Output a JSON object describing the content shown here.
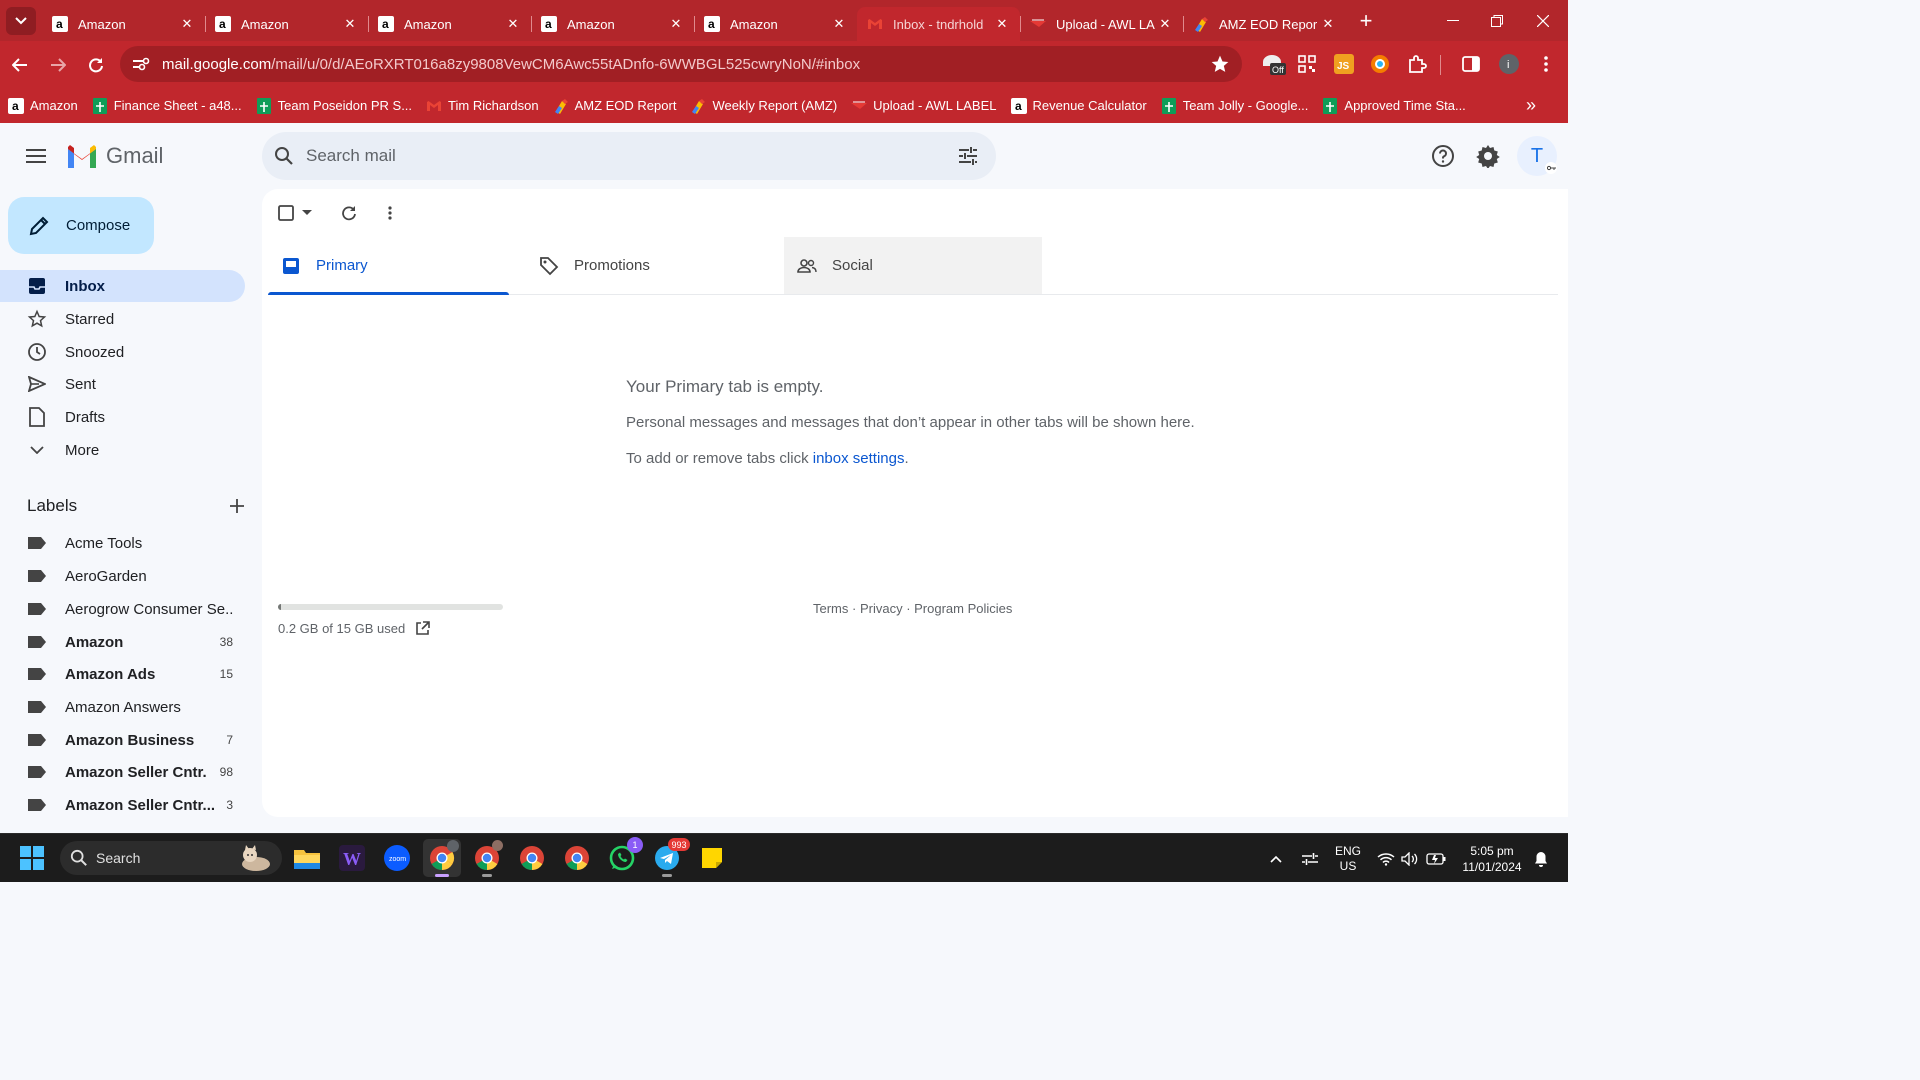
{
  "browser": {
    "tabs": [
      {
        "title": "Amazon",
        "favicon": "amazon-icon",
        "active": false
      },
      {
        "title": "Amazon",
        "favicon": "amazon-icon",
        "active": false
      },
      {
        "title": "Amazon",
        "favicon": "amazon-icon",
        "active": false
      },
      {
        "title": "Amazon",
        "favicon": "amazon-icon",
        "active": false
      },
      {
        "title": "Amazon",
        "favicon": "amazon-icon",
        "active": false
      },
      {
        "title": "Inbox - tndrhold",
        "favicon": "gmail-icon",
        "active": true
      },
      {
        "title": "Upload - AWL LA",
        "favicon": "awl-icon",
        "active": false
      },
      {
        "title": "AMZ EOD Repor",
        "favicon": "sheets-tool-icon",
        "active": false
      }
    ],
    "close_glyph": "✕",
    "new_tab_glyph": "+",
    "url_host": "mail.google.com",
    "url_path": "/mail/u/0/d/AEoRXRT016a8zy9808VewCM6Awc55tADnfo-6WWBGL525cwryNoN/#inbox",
    "extensions": {
      "off_badge": "Off",
      "js_label": "JS",
      "profile_initial": "i"
    },
    "bookmarks": [
      {
        "label": "Amazon",
        "icon": "amazon-icon"
      },
      {
        "label": "Finance Sheet - a48...",
        "icon": "sheets-icon"
      },
      {
        "label": "Team Poseidon PR S...",
        "icon": "sheets-icon"
      },
      {
        "label": "Tim Richardson",
        "icon": "gmail-icon"
      },
      {
        "label": "AMZ EOD Report",
        "icon": "tool-icon"
      },
      {
        "label": "Weekly Report (AMZ)",
        "icon": "tool-icon"
      },
      {
        "label": "Upload - AWL LABEL",
        "icon": "awl-icon"
      },
      {
        "label": "Revenue Calculator",
        "icon": "amazon-icon"
      },
      {
        "label": "Team Jolly - Google...",
        "icon": "sheets-icon"
      },
      {
        "label": "Approved Time Sta...",
        "icon": "sheets-icon"
      }
    ],
    "more_bookmarks": "»"
  },
  "gmail": {
    "product_name": "Gmail",
    "search_placeholder": "Search mail",
    "avatar_initial": "T",
    "compose_label": "Compose",
    "nav": [
      {
        "label": "Inbox",
        "icon": "inbox-icon",
        "active": true
      },
      {
        "label": "Starred",
        "icon": "star-icon"
      },
      {
        "label": "Snoozed",
        "icon": "clock-icon"
      },
      {
        "label": "Sent",
        "icon": "send-icon"
      },
      {
        "label": "Drafts",
        "icon": "draft-icon"
      },
      {
        "label": "More",
        "icon": "chevron-down-icon"
      }
    ],
    "labels_title": "Labels",
    "labels": [
      {
        "name": "Acme Tools",
        "count": "",
        "bold": false
      },
      {
        "name": "AeroGarden",
        "count": "",
        "bold": false
      },
      {
        "name": "Aerogrow Consumer Se...",
        "count": "",
        "bold": false
      },
      {
        "name": "Amazon",
        "count": "38",
        "bold": true
      },
      {
        "name": "Amazon Ads",
        "count": "15",
        "bold": true
      },
      {
        "name": "Amazon Answers",
        "count": "",
        "bold": false
      },
      {
        "name": "Amazon Business",
        "count": "7",
        "bold": true
      },
      {
        "name": "Amazon Seller Cntr.",
        "count": "98",
        "bold": true
      },
      {
        "name": "Amazon Seller Cntr...",
        "count": "3",
        "bold": true
      }
    ],
    "category_tabs": [
      {
        "label": "Primary",
        "icon": "inbox-tab-icon"
      },
      {
        "label": "Promotions",
        "icon": "tag-icon"
      },
      {
        "label": "Social",
        "icon": "people-icon"
      }
    ],
    "empty_title": "Your Primary tab is empty.",
    "empty_desc": "Personal messages and messages that don’t appear in other tabs will be shown here.",
    "empty_settings_prefix": "To add or remove tabs click ",
    "empty_settings_link": "inbox settings",
    "empty_settings_suffix": ".",
    "storage_text": "0.2 GB of 15 GB used",
    "storage_fraction": 0.013,
    "footer": {
      "terms": "Terms",
      "privacy": "Privacy",
      "policies": "Program Policies",
      "sep": " · "
    }
  },
  "taskbar": {
    "search_label": "Search",
    "whatsapp_badge": "1",
    "telegram_badge": "993",
    "lang_top": "ENG",
    "lang_bottom": "US",
    "time": "5:05 pm",
    "date": "11/01/2024"
  },
  "colors": {
    "chrome_red": "#c1272d",
    "gmail_blue": "#0b57d0",
    "compose_bg": "#c2e7ff"
  }
}
